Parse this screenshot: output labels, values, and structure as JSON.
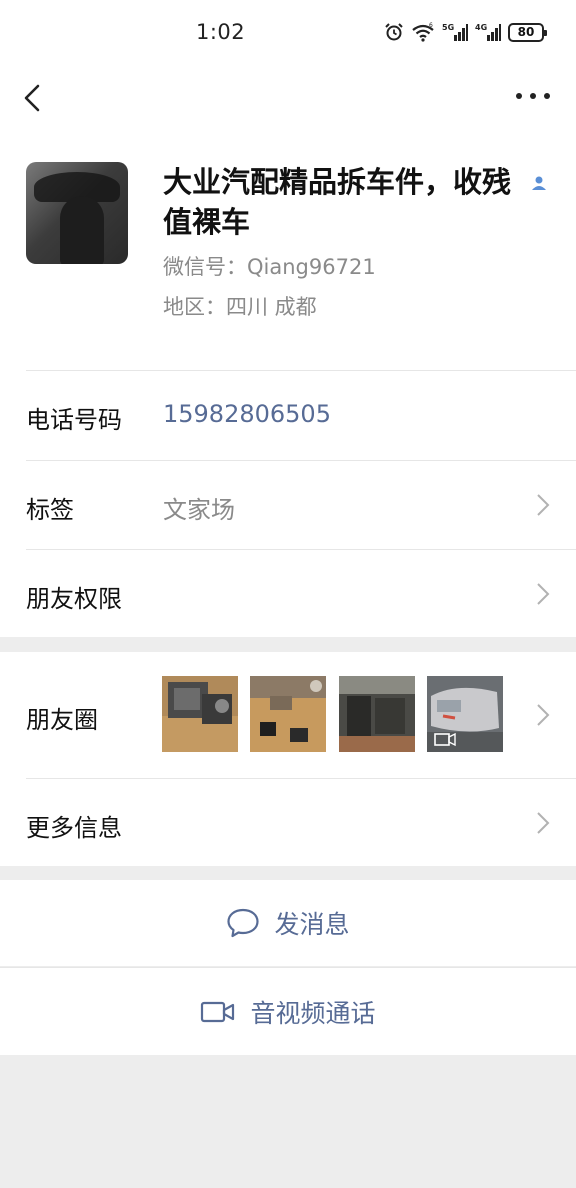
{
  "status_bar": {
    "time": "1:02",
    "battery": "80",
    "icons": [
      "alarm-icon",
      "wifi-icon",
      "5g-signal-icon",
      "4g-signal-icon",
      "battery-icon"
    ]
  },
  "nav": {
    "back_icon": "chevron-left-icon",
    "more_icon": "more-dots-icon"
  },
  "profile": {
    "name": "大业汽配精品拆车件，收残值裸车",
    "wechat_id": "微信号：Qiang96721",
    "region": "地区：四川  成都"
  },
  "rows": {
    "phone": {
      "label": "电话号码",
      "value": "15982806505"
    },
    "tags": {
      "label": "标签",
      "value": "文家场"
    },
    "permissions": {
      "label": "朋友权限"
    },
    "moments": {
      "label": "朋友圈"
    },
    "more_info": {
      "label": "更多信息"
    }
  },
  "actions": {
    "message": "发消息",
    "call": "音视频通话"
  },
  "colors": {
    "link": "#576b95",
    "secondary_text": "#8a8a8a",
    "background": "#ededed"
  }
}
